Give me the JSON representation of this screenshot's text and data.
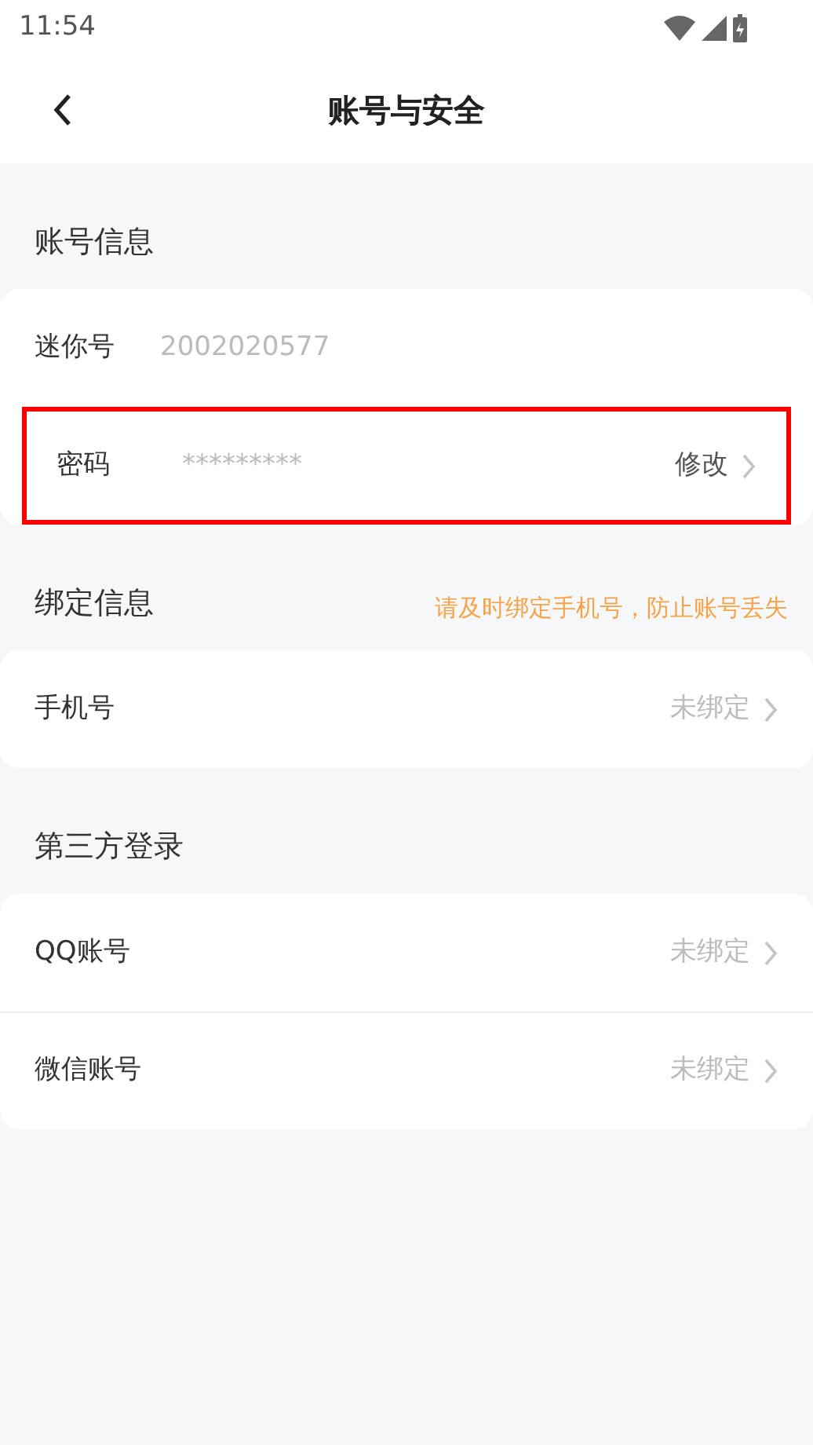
{
  "status_bar": {
    "time": "11:54"
  },
  "header": {
    "title": "账号与安全"
  },
  "sections": [
    {
      "title": "账号信息",
      "rows": [
        {
          "label": "迷你号",
          "value": "2002020577",
          "highlighted": false
        },
        {
          "label": "密码",
          "value": "*********",
          "action": "修改",
          "action_muted": false,
          "highlighted": true
        }
      ]
    },
    {
      "title": "绑定信息",
      "note": "请及时绑定手机号，防止账号丢失",
      "rows": [
        {
          "label": "手机号",
          "action": "未绑定",
          "action_muted": true,
          "highlighted": false
        }
      ]
    },
    {
      "title": "第三方登录",
      "rows": [
        {
          "label": "QQ账号",
          "action": "未绑定",
          "action_muted": true,
          "highlighted": false
        },
        {
          "label": "微信账号",
          "action": "未绑定",
          "action_muted": true,
          "highlighted": false
        }
      ]
    }
  ]
}
